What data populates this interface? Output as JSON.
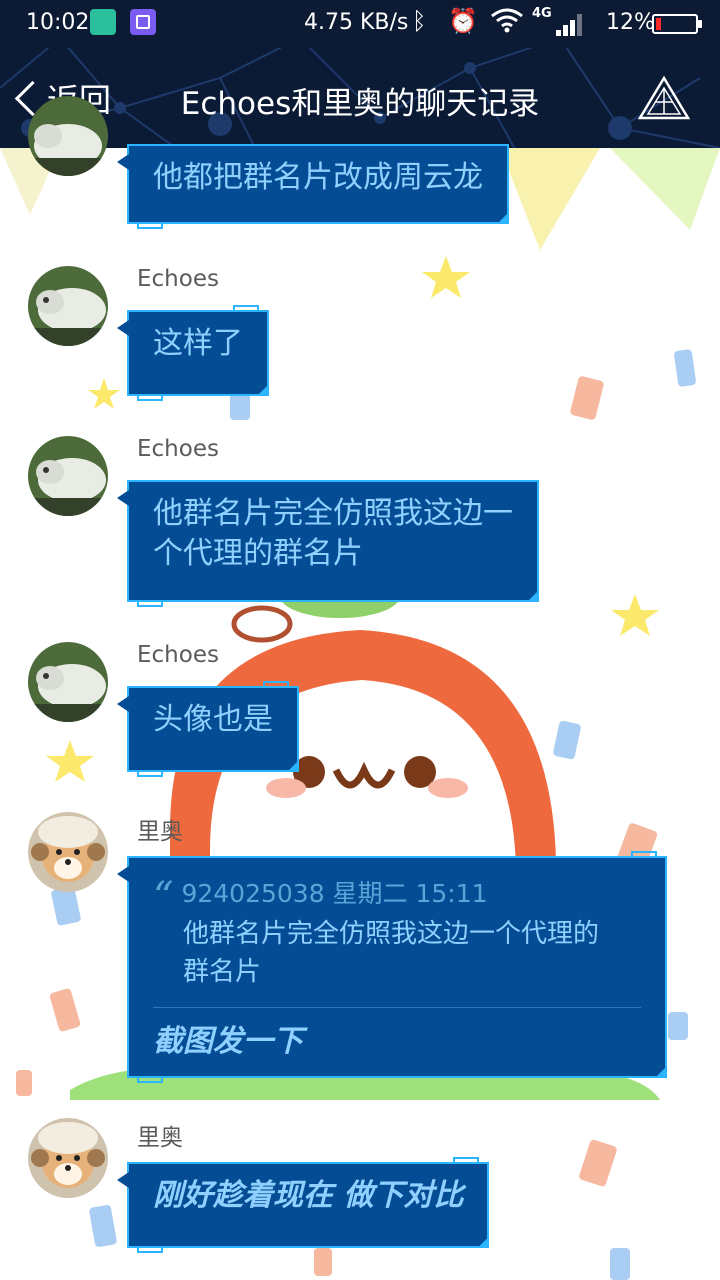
{
  "status_bar": {
    "time": "10:02",
    "net_speed": "4.75 KB/s",
    "network_type": "4G",
    "battery_percent": "12%",
    "battery_level": 0.12,
    "icons": [
      "battery-saver-app-icon",
      "gallery-app-icon",
      "bluetooth-icon",
      "alarm-icon",
      "wifi-icon",
      "signal-icon",
      "battery-icon"
    ]
  },
  "header": {
    "back_label": "返回",
    "title": "Echoes和里奥的聊天记录",
    "menu_icon": "pyramid-menu-icon"
  },
  "colors": {
    "header_bg": "#0b1a35",
    "bubble_bg": "#044d95",
    "bubble_border": "#2bb4ff",
    "bubble_text": "#8fd0ff"
  },
  "messages": [
    {
      "sender": "",
      "avatar": "echoes-avatar",
      "text": "他都把群名片改成周云龙"
    },
    {
      "sender": "Echoes",
      "avatar": "echoes-avatar",
      "text": "这样了"
    },
    {
      "sender": "Echoes",
      "avatar": "echoes-avatar",
      "text_line1": "他群名片完全仿照我这边一",
      "text_line2": "个代理的群名片"
    },
    {
      "sender": "Echoes",
      "avatar": "echoes-avatar",
      "text": "头像也是"
    },
    {
      "sender": "里奥",
      "avatar": "leo-avatar",
      "quote": {
        "meta": "924025038 星期二 15:11",
        "text_line1": "他群名片完全仿照我这边一个代理的",
        "text_line2": "群名片"
      },
      "text": "截图发一下"
    },
    {
      "sender": "里奥",
      "avatar": "leo-avatar",
      "text": "刚好趁着现在 做下对比"
    }
  ]
}
